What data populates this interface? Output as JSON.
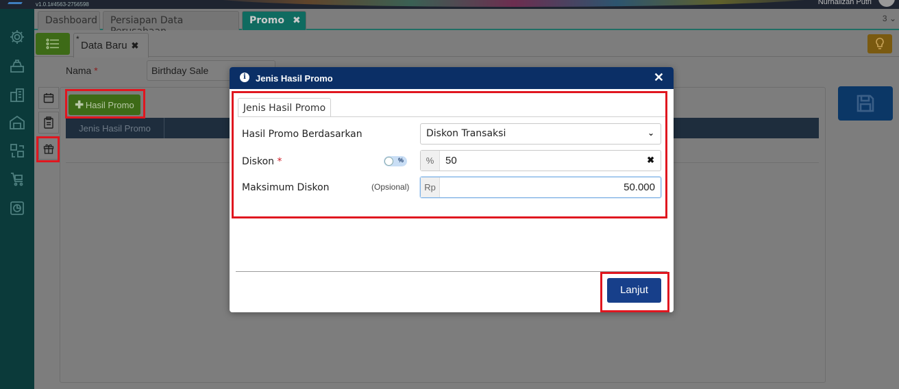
{
  "app": {
    "version": "v1.0.1#4563-2756598",
    "user_name": "Nurhalizah Putri",
    "open_tabs_count": "3"
  },
  "tabs": [
    {
      "label": "Dashboard"
    },
    {
      "label": "Persiapan Data Perusahaan"
    },
    {
      "label": "Promo",
      "close": "✖"
    }
  ],
  "subtab": {
    "marker": "*",
    "label": "Data Baru",
    "close": "✖"
  },
  "form": {
    "nama_label": "Nama",
    "nama_required": "*",
    "nama_value": "Birthday Sale"
  },
  "panel": {
    "add_button_label": "Hasil Promo",
    "add_button_icon": "plus-icon",
    "grid_columns": [
      "Jenis Hasil Promo"
    ]
  },
  "modal": {
    "title": "Jenis Hasil Promo",
    "close": "✕",
    "tab_label": "Jenis Hasil Promo",
    "fields": {
      "hasil_label": "Hasil Promo Berdasarkan",
      "hasil_value": "Diskon Transaksi",
      "diskon_label": "Diskon",
      "diskon_required": "*",
      "diskon_toggle_text": "%",
      "diskon_addon": "%",
      "diskon_value": "50",
      "maks_label": "Maksimum Diskon",
      "maks_optional": "(Opsional)",
      "maks_addon": "Rp",
      "maks_value": "50.000"
    },
    "submit_label": "Lanjut"
  },
  "colors": {
    "highlight": "#e0161f",
    "modal_header": "#0b2f66",
    "primary_button": "#173f8a",
    "green_button": "#3d6a17"
  }
}
